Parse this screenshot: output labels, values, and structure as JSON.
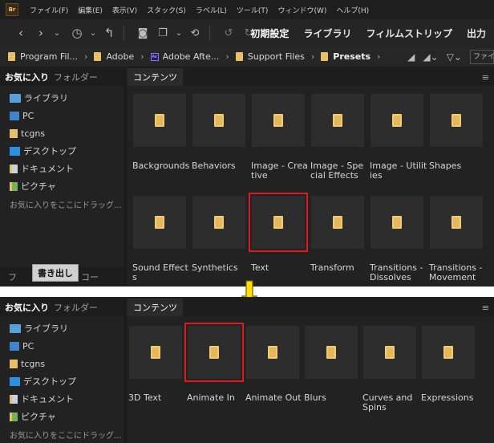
{
  "shot1": {
    "app_logo": "Br",
    "menu": [
      "ファイル(F)",
      "編集(E)",
      "表示(V)",
      "スタック(S)",
      "ラベル(L)",
      "ツール(T)",
      "ウィンドウ(W)",
      "ヘルプ(H)"
    ],
    "workspaces": [
      "初期設定",
      "ライブラリ",
      "フィルムストリップ",
      "出力"
    ],
    "breadcrumb": [
      "Program Fil...",
      "Adobe",
      "Adobe Afte...",
      "Support Files",
      "Presets"
    ],
    "filter_placeholder": "ファイル",
    "left_tabs": {
      "favorites": "お気に入り",
      "folders": "フォルダー"
    },
    "favorites": [
      "ライブラリ",
      "PC",
      "tcgns",
      "デスクトップ",
      "ドキュメント",
      "ピクチャ"
    ],
    "favorites_hint": "お気に入りをここにドラッグ...",
    "content_tab": "コンテンツ",
    "bottom_tabs": {
      "left": "フ",
      "export": "書き出し",
      "right": "コー"
    },
    "items": [
      "Backgrounds",
      "Behaviors",
      "Image - Creative",
      "Image - Special Effects",
      "Image - Utilities",
      "Shapes",
      "Sound Effects",
      "Synthetics",
      "Text",
      "Transform",
      "Transitions - Dissolves",
      "Transitions - Movement"
    ],
    "selected_item": "Text"
  },
  "shot2": {
    "left_tabs": {
      "favorites": "お気に入り",
      "folders": "フォルダー"
    },
    "favorites": [
      "ライブラリ",
      "PC",
      "tcgns",
      "デスクトップ",
      "ドキュメント",
      "ピクチャ"
    ],
    "favorites_hint": "お気に入りをここにドラッグ...",
    "content_tab": "コンテンツ",
    "items": [
      "3D Text",
      "Animate In",
      "Animate Out",
      "Blurs",
      "Curves and Spins",
      "Expressions"
    ],
    "selected_item": "Animate In"
  },
  "colors": {
    "highlight": "#e0191f",
    "arrow": "#ffe000",
    "folder": "#f2ca72"
  },
  "icons": [
    "back-icon",
    "forward-icon",
    "history-icon",
    "boomerang-icon",
    "camera-icon",
    "batch-icon",
    "refresh-icon",
    "rotate-left-icon",
    "rotate-right-icon",
    "folder-icon",
    "stars-icon",
    "sort-icon",
    "panel-menu-icon"
  ]
}
